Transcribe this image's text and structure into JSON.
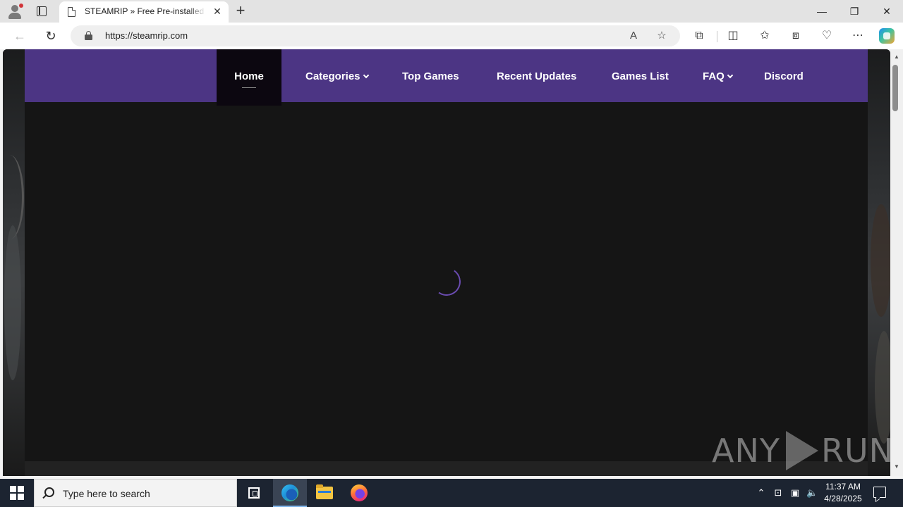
{
  "browser": {
    "tab_title": "STEAMRIP » Free Pre-installed Steam Games",
    "url": "https://steamrip.com",
    "icons": {
      "profile": "profile-icon",
      "tab_actions": "tab-actions-icon",
      "page": "page-icon",
      "close_tab": "close-icon",
      "new_tab": "plus-icon",
      "back": "back-arrow-icon",
      "refresh": "refresh-icon",
      "lock": "lock-icon",
      "read_aloud": "read-aloud-icon",
      "favorite": "star-icon",
      "extensions": "puzzle-icon",
      "split": "split-screen-icon",
      "favorites": "favorites-icon",
      "collections": "collections-icon",
      "performance": "heart-pulse-icon",
      "more": "ellipsis-icon",
      "copilot": "copilot-icon"
    }
  },
  "site": {
    "nav": [
      {
        "label": "Home",
        "active": true,
        "dropdown": false
      },
      {
        "label": "Categories",
        "active": false,
        "dropdown": true
      },
      {
        "label": "Top Games",
        "active": false,
        "dropdown": false
      },
      {
        "label": "Recent Updates",
        "active": false,
        "dropdown": false
      },
      {
        "label": "Games List",
        "active": false,
        "dropdown": false
      },
      {
        "label": "FAQ",
        "active": false,
        "dropdown": true
      },
      {
        "label": "Discord",
        "active": false,
        "dropdown": false
      }
    ],
    "colors": {
      "nav_bg": "#4c3584",
      "active_bg": "#0c0710",
      "page_bg": "#151515",
      "spinner": "#6a4bb0"
    }
  },
  "watermark": {
    "left": "ANY",
    "right": "RUN"
  },
  "taskbar": {
    "search_placeholder": "Type here to search",
    "time": "11:37 AM",
    "date": "4/28/2025",
    "apps": [
      "task-view-icon",
      "edge-icon",
      "file-explorer-icon",
      "firefox-icon"
    ],
    "tray_icons": [
      "chevron-up-icon",
      "network-adapter-icon",
      "network-icon",
      "volume-icon",
      "notification-icon"
    ]
  }
}
